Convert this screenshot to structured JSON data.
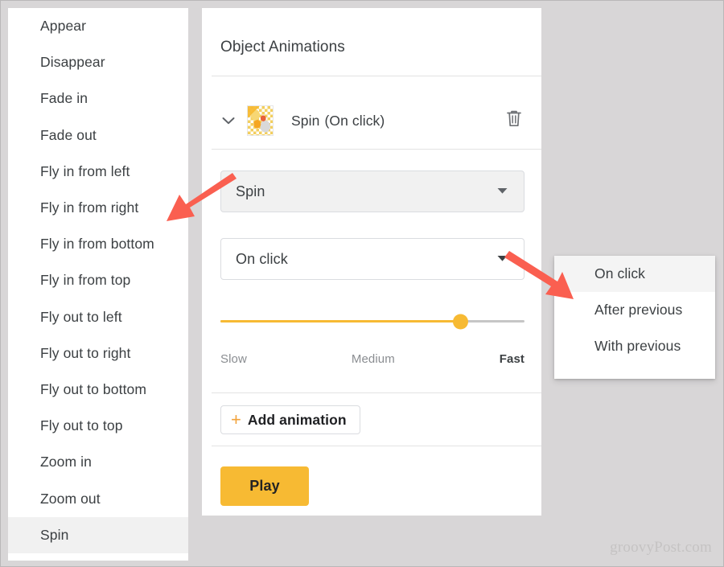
{
  "sidebar": {
    "items": [
      {
        "label": "Appear",
        "selected": false
      },
      {
        "label": "Disappear",
        "selected": false
      },
      {
        "label": "Fade in",
        "selected": false
      },
      {
        "label": "Fade out",
        "selected": false
      },
      {
        "label": "Fly in from left",
        "selected": false
      },
      {
        "label": "Fly in from right",
        "selected": false
      },
      {
        "label": "Fly in from bottom",
        "selected": false
      },
      {
        "label": "Fly in from top",
        "selected": false
      },
      {
        "label": "Fly out to left",
        "selected": false
      },
      {
        "label": "Fly out to right",
        "selected": false
      },
      {
        "label": "Fly out to bottom",
        "selected": false
      },
      {
        "label": "Fly out to top",
        "selected": false
      },
      {
        "label": "Zoom in",
        "selected": false
      },
      {
        "label": "Zoom out",
        "selected": false
      },
      {
        "label": "Spin",
        "selected": true
      }
    ]
  },
  "panel": {
    "title": "Object Animations",
    "summary": {
      "expand_icon": "chevron-down-icon",
      "thumbnail_alt": "slide-object-thumbnail",
      "effect": "Spin",
      "trigger": "(On click)",
      "delete_icon": "trash-icon"
    },
    "effect_select": {
      "value": "Spin",
      "caret_icon": "caret-down-icon"
    },
    "trigger_select": {
      "value": "On click",
      "caret_icon": "caret-down-icon"
    },
    "speed_slider": {
      "value_percent": 79,
      "label_min": "Slow",
      "label_mid": "Medium",
      "label_max": "Fast"
    },
    "add_animation": {
      "plus_icon": "plus-icon",
      "label": "Add animation"
    },
    "play_button": "Play"
  },
  "popup_menu": {
    "items": [
      {
        "label": "On click",
        "selected": true
      },
      {
        "label": "After previous",
        "selected": false
      },
      {
        "label": "With previous",
        "selected": false
      }
    ]
  },
  "annotations": {
    "arrow_color": "#fa5f50",
    "arrow_left_name": "annotation-arrow-to-spin-option",
    "arrow_right_name": "annotation-arrow-to-trigger-menu"
  },
  "watermark": "groovyPost.com"
}
